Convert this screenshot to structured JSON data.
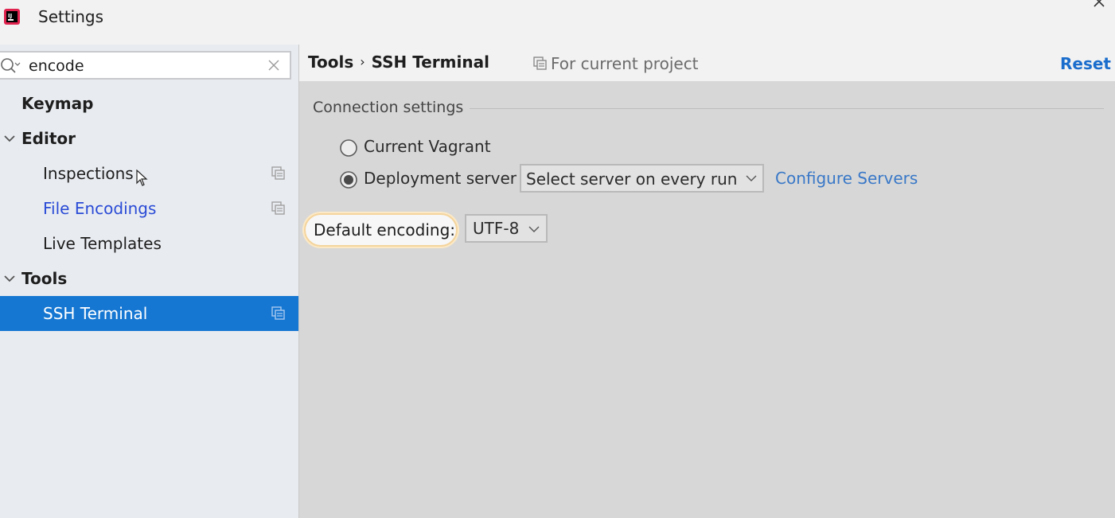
{
  "window": {
    "title": "Settings",
    "app_icon": "intellij-app-icon",
    "close_icon": "close-icon"
  },
  "sidebar": {
    "search": {
      "value": "encode",
      "placeholder": ""
    },
    "items": [
      {
        "label": "Keymap"
      },
      {
        "label": "Editor"
      },
      {
        "label": "Inspections"
      },
      {
        "label": "File Encodings"
      },
      {
        "label": "Live Templates"
      },
      {
        "label": "Tools"
      },
      {
        "label": "SSH Terminal"
      }
    ]
  },
  "header": {
    "breadcrumb": [
      "Tools",
      "SSH Terminal"
    ],
    "breadcrumb_separator": "›",
    "scope": "For current project",
    "reset": "Reset"
  },
  "connection": {
    "group_title": "Connection settings",
    "options": [
      {
        "label": "Current Vagrant",
        "selected": false
      },
      {
        "label": "Deployment server",
        "selected": true
      }
    ],
    "server_select": "Select server on every run",
    "configure_link": "Configure Servers"
  },
  "encoding": {
    "label": "Default encoding:",
    "value": "UTF-8"
  },
  "colors": {
    "selection": "#1677d2",
    "link": "#2a4bd6",
    "accent_link": "#1a6dcc",
    "highlight_border": "#f4d49c"
  }
}
